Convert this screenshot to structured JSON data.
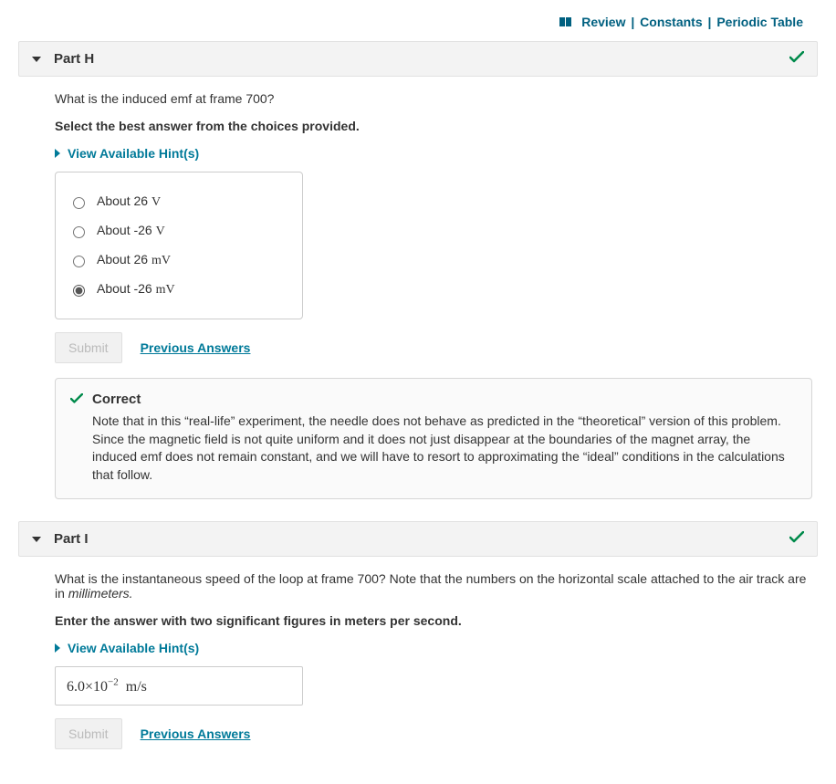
{
  "top_links": {
    "review": "Review",
    "constants": "Constants",
    "periodic": "Periodic Table"
  },
  "part_h": {
    "title": "Part H",
    "question": "What is the induced emf at frame 700?",
    "instruction": "Select the best answer from the choices provided.",
    "hints_label": "View Available Hint(s)",
    "choices": {
      "a_pre": "About 26 ",
      "a_unit": "V",
      "b_pre": "About -26 ",
      "b_unit": "V",
      "c_pre": "About 26 ",
      "c_unit": "mV",
      "d_pre": "About -26 ",
      "d_unit": "mV"
    },
    "submit_label": "Submit",
    "prev_label": "Previous Answers",
    "feedback": {
      "title": "Correct",
      "text": "Note that in this “real-life” experiment, the needle does not behave as predicted in the “theoretical” version of this problem. Since the magnetic field is not quite uniform and it does not just disappear at the boundaries of the magnet array, the induced emf does not remain constant, and we will have to resort to approximating the “ideal” conditions in the calculations that follow."
    }
  },
  "part_i": {
    "title": "Part I",
    "question_pre": "What is the instantaneous speed of the loop at frame 700? Note that the numbers on the horizontal scale attached to the air track are in ",
    "question_unit": "millimeters.",
    "instruction": "Enter the answer with two significant figures in meters per second.",
    "hints_label": "View Available Hint(s)",
    "answer_pre": "6.0×10",
    "answer_exp": "−2",
    "answer_unit": "  m/s",
    "submit_label": "Submit",
    "prev_label": "Previous Answers"
  }
}
